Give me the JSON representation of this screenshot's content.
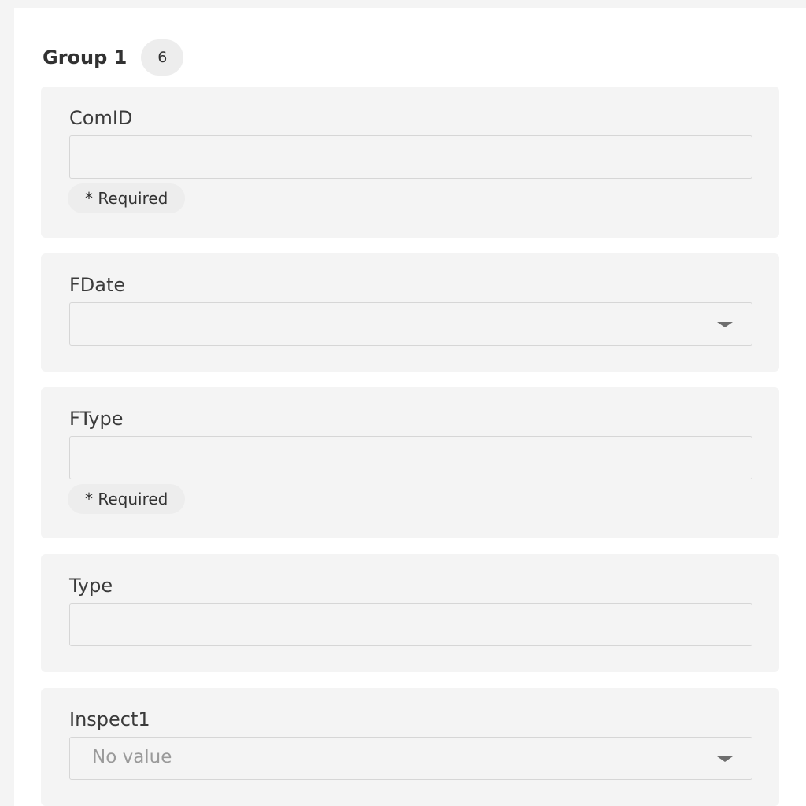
{
  "group": {
    "title": "Group 1",
    "count": "6"
  },
  "fields": [
    {
      "label": "ComID",
      "value": "",
      "required_text": "* Required"
    },
    {
      "label": "FDate",
      "value": ""
    },
    {
      "label": "FType",
      "value": "",
      "required_text": "* Required"
    },
    {
      "label": "Type",
      "value": ""
    },
    {
      "label": "Inspect1",
      "value": "No value"
    }
  ],
  "icons": {
    "dropdown": "chevron-down-icon"
  },
  "colors": {
    "card_bg": "#f4f4f4",
    "panel_bg": "#ffffff",
    "border": "#d6d6d6",
    "placeholder": "#9a9a9a"
  }
}
